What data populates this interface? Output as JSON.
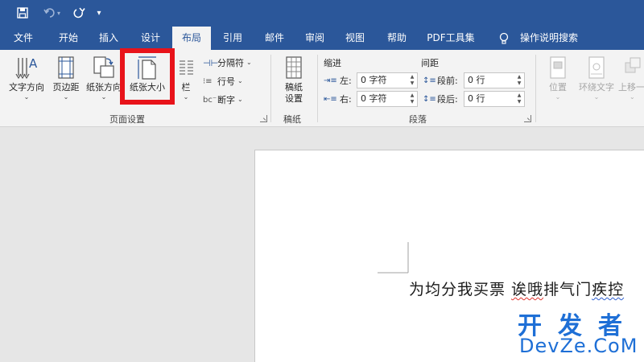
{
  "tabs": [
    "文件",
    "开始",
    "插入",
    "设计",
    "布局",
    "引用",
    "邮件",
    "审阅",
    "视图",
    "帮助",
    "PDF工具集"
  ],
  "search_label": "操作说明搜索",
  "ribbon": {
    "page_setup": {
      "text_direction": "文字方向",
      "margins": "页边距",
      "orientation": "纸张方向",
      "size": "纸张大小",
      "columns": "栏",
      "breaks": "分隔符",
      "line_numbers": "行号",
      "hyphenation": "断字",
      "group_label": "页面设置"
    },
    "manuscript": {
      "button_line1": "稿纸",
      "button_line2": "设置",
      "group_label": "稿纸"
    },
    "paragraph": {
      "indent_heading": "缩进",
      "spacing_heading": "间距",
      "left_label": "左:",
      "right_label": "右:",
      "before_label": "段前:",
      "after_label": "段后:",
      "left_value": "0 字符",
      "right_value": "0 字符",
      "before_value": "0 行",
      "after_value": "0 行",
      "group_label": "段落"
    },
    "arrange": {
      "position": "位置",
      "wrap_text": "环绕文字",
      "bring_forward": "上移一"
    }
  },
  "document": {
    "text_plain": "为均分我买票  ",
    "text_red": "诶哦",
    "text_rest": "排气门",
    "text_blue": "疾控"
  },
  "watermark": {
    "cn": "开发者",
    "en": "DevZe.CoM"
  },
  "colors": {
    "brand": "#2b579a",
    "highlight": "#e8131a",
    "watermark": "#1e6fd6"
  }
}
